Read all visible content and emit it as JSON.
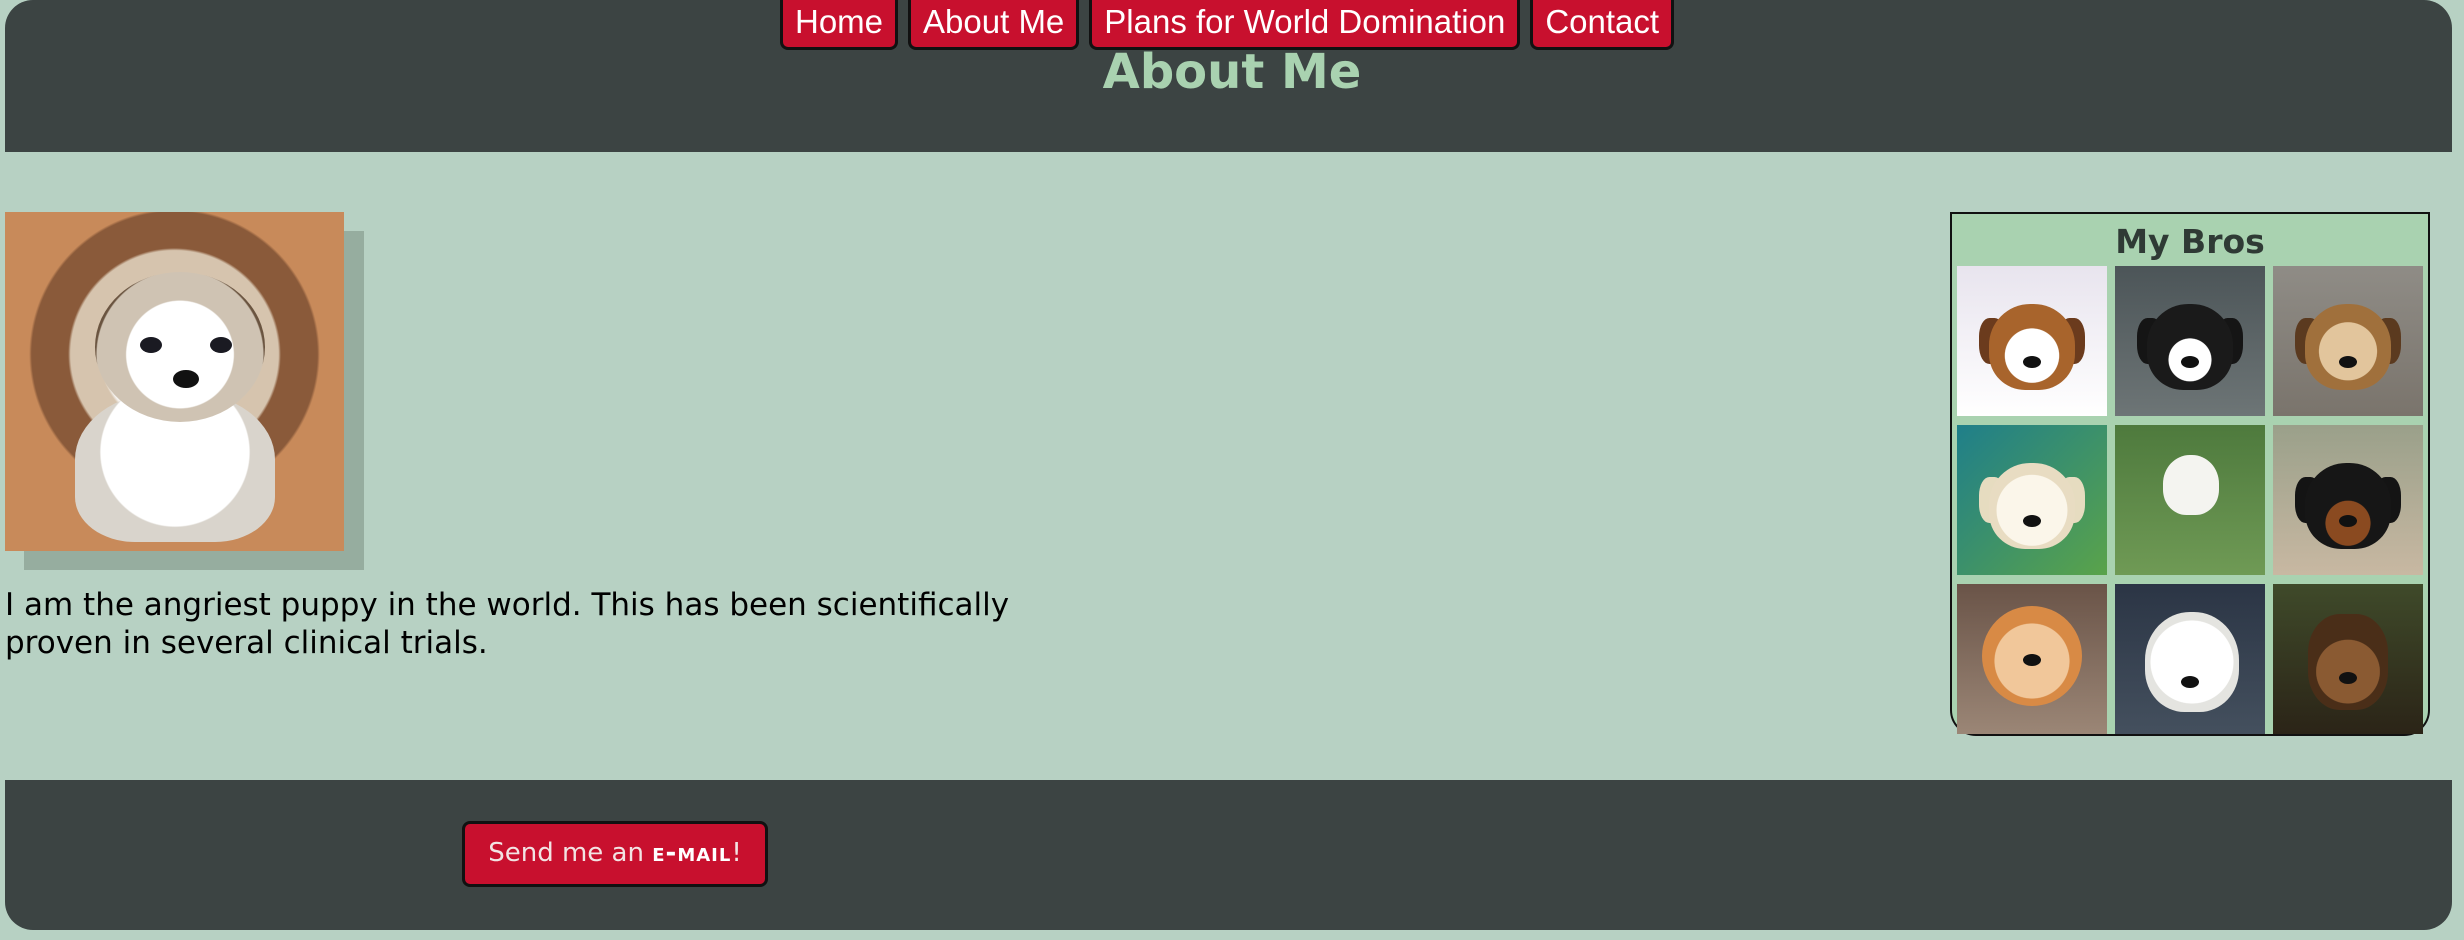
{
  "nav": {
    "items": [
      {
        "label": "Home"
      },
      {
        "label": "About Me"
      },
      {
        "label": "Plans for World Domination"
      },
      {
        "label": "Contact"
      }
    ]
  },
  "header": {
    "title": "About Me"
  },
  "main": {
    "bio": "I am the angriest puppy in the world. This has been scientifically proven in several clinical trials."
  },
  "sidebar": {
    "title": "My Bros",
    "photos": [
      {
        "icon": "beagle-puppy-photo"
      },
      {
        "icon": "black-white-puppy-photo"
      },
      {
        "icon": "tan-puppy-waving-photo"
      },
      {
        "icon": "lab-puppy-photo"
      },
      {
        "icon": "white-puppy-running-photo"
      },
      {
        "icon": "rottweiler-puppy-photo"
      },
      {
        "icon": "fluffy-orange-puppy-photo"
      },
      {
        "icon": "white-fluffy-puppy-photo"
      },
      {
        "icon": "ewok-photo"
      }
    ]
  },
  "footer": {
    "email_prefix": "Send me an ",
    "email_strong": "e-mail",
    "email_suffix": "!"
  },
  "colors": {
    "background": "#b7d1c3",
    "header_footer": "#3c4443",
    "accent_red": "#c8102e",
    "title_green": "#a9d2b0"
  }
}
